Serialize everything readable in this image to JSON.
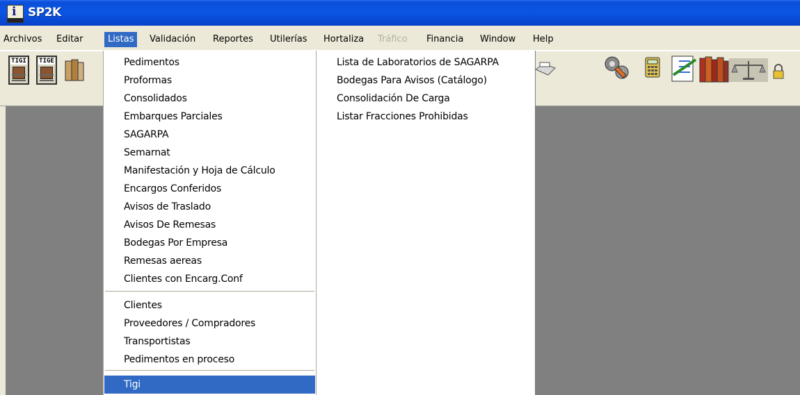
{
  "window": {
    "title": "SP2K",
    "icon": "app-icon"
  },
  "menubar": [
    {
      "label": "Archivos",
      "state": "normal"
    },
    {
      "label": "Editar",
      "state": "normal"
    },
    {
      "label": "Listas",
      "state": "active"
    },
    {
      "label": "Validación",
      "state": "normal"
    },
    {
      "label": "Reportes",
      "state": "normal"
    },
    {
      "label": "Utilerías",
      "state": "normal"
    },
    {
      "label": "Hortaliza",
      "state": "normal"
    },
    {
      "label": "Tráfico",
      "state": "disabled"
    },
    {
      "label": "Financia",
      "state": "normal"
    },
    {
      "label": "Window",
      "state": "normal"
    },
    {
      "label": "Help",
      "state": "normal"
    }
  ],
  "toolbar": {
    "buttons": [
      {
        "label": "TIGI",
        "icon": "tigi-icon"
      },
      {
        "label": "TIGE",
        "icon": "tige-icon"
      }
    ],
    "icons": [
      "books-icon",
      "printer-icon",
      "settings-icon",
      "calculator-icon",
      "checklist-icon",
      "library-icon",
      "scales-icon",
      "lock-icon"
    ]
  },
  "listas_menu": {
    "group1": [
      "Pedimentos",
      "Proformas",
      "Consolidados",
      "Embarques Parciales",
      "SAGARPA",
      "Semarnat",
      "Manifestación y Hoja de Cálculo",
      "Encargos Conferidos",
      "Avisos de Traslado",
      "Avisos De Remesas",
      "Bodegas Por Empresa",
      "Remesas aereas",
      "Clientes con Encarg.Conf"
    ],
    "group2": [
      "Clientes",
      "Proveedores / Compradores",
      "Transportistas",
      "Pedimentos en proceso"
    ],
    "selected": "Tigi"
  },
  "listas_menu_col2": [
    "Lista de Laboratorios de SAGARPA",
    "Bodegas Para Avisos (Catálogo)",
    "Consolidación De Carga",
    "Listar Fracciones Prohibidas"
  ],
  "colors": {
    "titlebar": "#0b55e6",
    "menubar": "#ece9d8",
    "highlight": "#316ac5",
    "workspace": "#808080"
  }
}
